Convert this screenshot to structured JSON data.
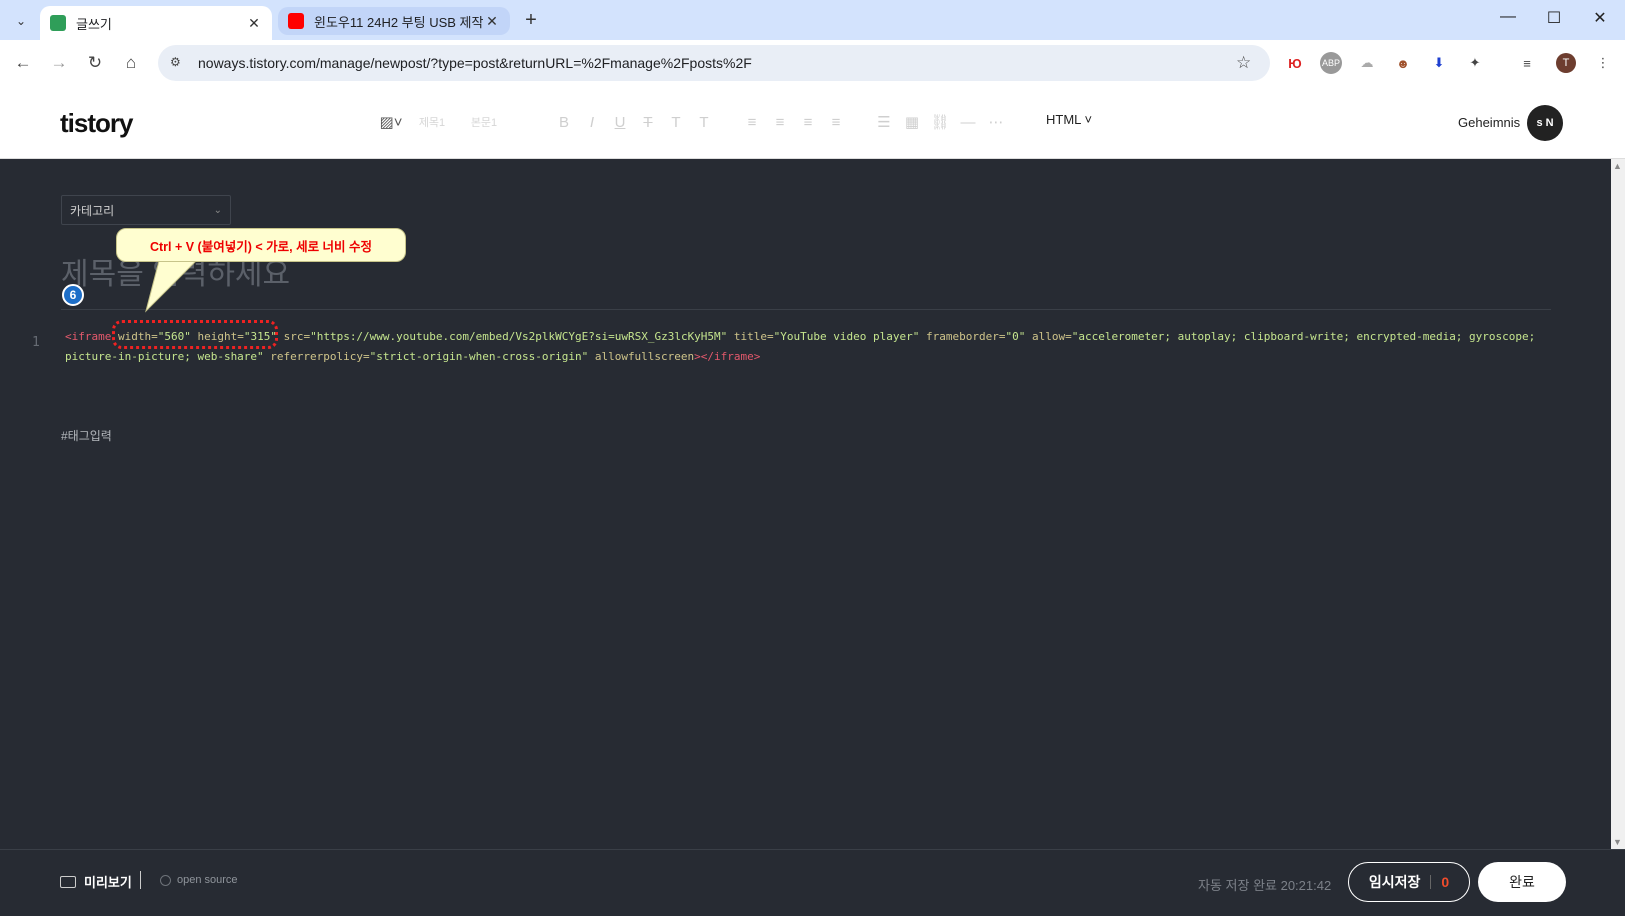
{
  "browser": {
    "tabs": [
      {
        "title": "글쓰기",
        "close": "✕"
      },
      {
        "title": "윈도우11 24H2 부팅 USB 제작",
        "close": "✕"
      }
    ],
    "new_tab": "+",
    "url": "noways.tistory.com/manage/newpost/?type=post&returnURL=%2Fmanage%2Fposts%2F",
    "window": {
      "minimize": "—",
      "maximize": "☐",
      "close": "✕"
    },
    "profile_initial": "T",
    "extensions": [
      "Ю",
      "ABP",
      "",
      "",
      "",
      ""
    ]
  },
  "header": {
    "logo": "tistory",
    "toolbar": {
      "heading": "제목1",
      "body": "본문1",
      "mode": "HTML"
    },
    "user_name": "Geheimnis",
    "avatar_text": "s N"
  },
  "editor": {
    "category_placeholder": "카테고리",
    "title_placeholder": "제목을 입력하세요",
    "line_number": "1",
    "code": {
      "t1": "<iframe",
      "a1": " width=",
      "v1": "\"560\"",
      "a2": " height=",
      "v2": "\"315\"",
      "a3": " src=",
      "v3": "\"https://www.youtube.com/embed/Vs2plkWCYgE?si=uwRSX_Gz3lcKyH5M\"",
      "a4": " title=",
      "v4": "\"YouTube video player\"",
      "a5": " frameborder=",
      "v5": "\"0\"",
      "a6": " allow=",
      "v6": "\"accelerometer; autoplay; clipboard-write; encrypted-media; gyroscope; picture-in-picture; web-share\"",
      "a7": " referrerpolicy=",
      "v7": "\"strict-origin-when-cross-origin\"",
      "a8": " allowfullscreen",
      "t2": "></iframe>"
    },
    "tag_placeholder": "#태그입력",
    "callout_text": "Ctrl + V (붙여넣기) < 가로, 세로 너비 수정",
    "step_number": "6"
  },
  "footer": {
    "preview_label": "미리보기",
    "open_source_label": "open source",
    "autosave_text": "자동 저장 완료 20:21:42",
    "draft_label": "임시저장",
    "draft_count": "0",
    "done_label": "완료"
  }
}
